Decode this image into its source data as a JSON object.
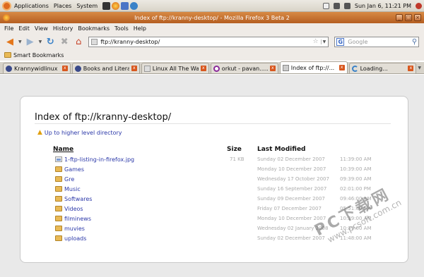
{
  "panel": {
    "menus": [
      "Applications",
      "Places",
      "System"
    ],
    "clock": "Sun Jan  6, 11:21 PM"
  },
  "window": {
    "title": "Index of ftp://kranny-desktop/ - Mozilla Firefox 3 Beta 2",
    "buttons": [
      "_",
      "□",
      "×"
    ]
  },
  "menubar": {
    "items": [
      "File",
      "Edit",
      "View",
      "History",
      "Bookmarks",
      "Tools",
      "Help"
    ]
  },
  "navbar": {
    "url": "ftp://kranny-desktop/",
    "search_placeholder": "Google",
    "search_engine_letter": "G"
  },
  "bookmarks": {
    "label": "Smart Bookmarks"
  },
  "tabs": [
    {
      "label": "Krannywidlinux",
      "icon_color": "#3a4a8a"
    },
    {
      "label": "Books and Litera...",
      "icon_color": "#3a4a8a"
    },
    {
      "label": "Linux All The Way...",
      "icon_color": "#dddddd"
    },
    {
      "label": "orkut - pavan........",
      "icon_color": "#8a2a9a"
    },
    {
      "label": "Index of ftp://...",
      "icon_color": "#cccccc",
      "active": true
    },
    {
      "label": "Loading...",
      "icon_color": "#3a82c8"
    }
  ],
  "page": {
    "title": "Index of ftp://kranny-desktop/",
    "up_link": "Up to higher level directory",
    "columns": {
      "name": "Name",
      "size": "Size",
      "modified": "Last Modified"
    },
    "rows": [
      {
        "name": "1-ftp-listing-in-firefox.jpg",
        "size": "71 KB",
        "date": "Sunday 02 December 2007",
        "time": "11:39:00 AM",
        "type": "file"
      },
      {
        "name": "Games",
        "size": "",
        "date": "Monday 10 December 2007",
        "time": "10:39:00 AM",
        "type": "folder"
      },
      {
        "name": "Gre",
        "size": "",
        "date": "Wednesday 17 October 2007",
        "time": "09:39:00 AM",
        "type": "folder"
      },
      {
        "name": "Music",
        "size": "",
        "date": "Sunday 16 September 2007",
        "time": "02:01:00 PM",
        "type": "folder"
      },
      {
        "name": "Softwares",
        "size": "",
        "date": "Sunday 09 December 2007",
        "time": "09:46:00 AM",
        "type": "folder"
      },
      {
        "name": "Videos",
        "size": "",
        "date": "Friday 07 December 2007",
        "time": "05:51:00 PM",
        "type": "folder"
      },
      {
        "name": "filminews",
        "size": "",
        "date": "Monday 10 December 2007",
        "time": "10:39:00 AM",
        "type": "folder"
      },
      {
        "name": "muvies",
        "size": "",
        "date": "Wednesday 02 January 2008",
        "time": "10:39:00 AM",
        "type": "folder"
      },
      {
        "name": "uploads",
        "size": "",
        "date": "Sunday 02 December 2007",
        "time": "11:48:00 AM",
        "type": "folder"
      }
    ]
  },
  "watermark": {
    "big": "PC下载网",
    "small": "www.pcsoft.com.cn"
  },
  "colors": {
    "titlebar": "#c56b2c",
    "link": "#2a37a8",
    "tab_close": "#d8571e",
    "folder": "#e9b955"
  }
}
